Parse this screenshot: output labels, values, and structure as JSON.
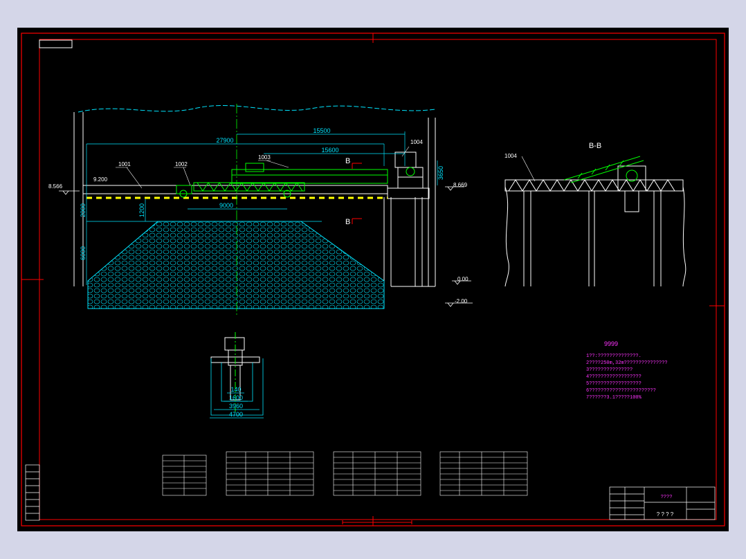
{
  "colors": {
    "background": "#d4d6e8",
    "sheet": "#000000",
    "frame": "#ff0000",
    "dimension": "#00e5ff",
    "structure": "#ffffff",
    "annotation": "#ff33ff",
    "equipment": "#00ff00",
    "hatch": "#00e5ff",
    "centerline": "#00ff00"
  },
  "elevation_view": {
    "dims": {
      "d15500": "15500",
      "d27900": "27900",
      "d15600": "15600",
      "d9000": "9000",
      "d3650": "3650",
      "d2000": "2000",
      "d1200": "1200",
      "d6000": "6000"
    },
    "levels": {
      "left": "8.566",
      "right": "8.669",
      "belt": "9.200",
      "ground": "0.00",
      "pit": "-2.00"
    },
    "parts": {
      "p1001": "1001",
      "p1002": "1002",
      "p1003": "1003",
      "p1004": "1004"
    },
    "section_marks": {
      "top": "B",
      "bottom": "B"
    }
  },
  "section_view": {
    "title": "B-B",
    "part": "1004"
  },
  "cross_section": {
    "dims": {
      "d140": "140",
      "d1600": "1600",
      "d3960": "3960",
      "d4700": "4700"
    }
  },
  "notes": {
    "title": "9999",
    "lines": [
      "1??:??????????????.",
      "2????250m,32m???????????????",
      "3???????????????",
      "4??????????????????",
      "5??????????????????",
      "6???????????????????????",
      "7??????3.1?????100%"
    ]
  },
  "title_block": {
    "drawing_name": "????",
    "scale_text": "? ? ? ?"
  }
}
